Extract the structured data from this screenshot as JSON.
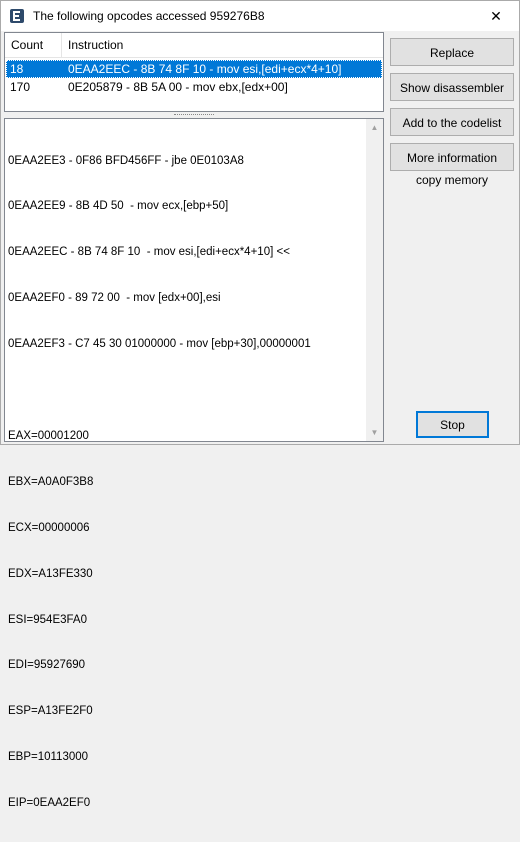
{
  "window": {
    "title": "The following opcodes accessed 959276B8",
    "close_glyph": "✕"
  },
  "list": {
    "columns": [
      "Count",
      "Instruction"
    ],
    "rows": [
      {
        "count": "18",
        "instruction": "0EAA2EEC - 8B 74 8F 10  - mov esi,[edi+ecx*4+10]",
        "selected": true
      },
      {
        "count": "170",
        "instruction": "0E205879 - 8B 5A 00  - mov ebx,[edx+00]",
        "selected": false
      }
    ]
  },
  "memo": {
    "lines": [
      "0EAA2EE3 - 0F86 BFD456FF - jbe 0E0103A8",
      "0EAA2EE9 - 8B 4D 50  - mov ecx,[ebp+50]",
      "0EAA2EEC - 8B 74 8F 10  - mov esi,[edi+ecx*4+10] <<",
      "0EAA2EF0 - 89 72 00  - mov [edx+00],esi",
      "0EAA2EF3 - C7 45 30 01000000 - mov [ebp+30],00000001",
      "",
      "EAX=00001200",
      "EBX=A0A0F3B8",
      "ECX=00000006",
      "EDX=A13FE330",
      "ESI=954E3FA0",
      "EDI=95927690",
      "ESP=A13FE2F0",
      "EBP=10113000",
      "EIP=0EAA2EF0"
    ]
  },
  "buttons": {
    "replace": "Replace",
    "show_disassembler": "Show disassembler",
    "add_to_codelist": "Add to the codelist",
    "more_information": "More information",
    "stop": "Stop"
  },
  "copy_memory_label": "copy memory",
  "colors": {
    "selection": "#0078d7",
    "button_face": "#e1e1e1",
    "window_bg": "#f0f0f0"
  }
}
